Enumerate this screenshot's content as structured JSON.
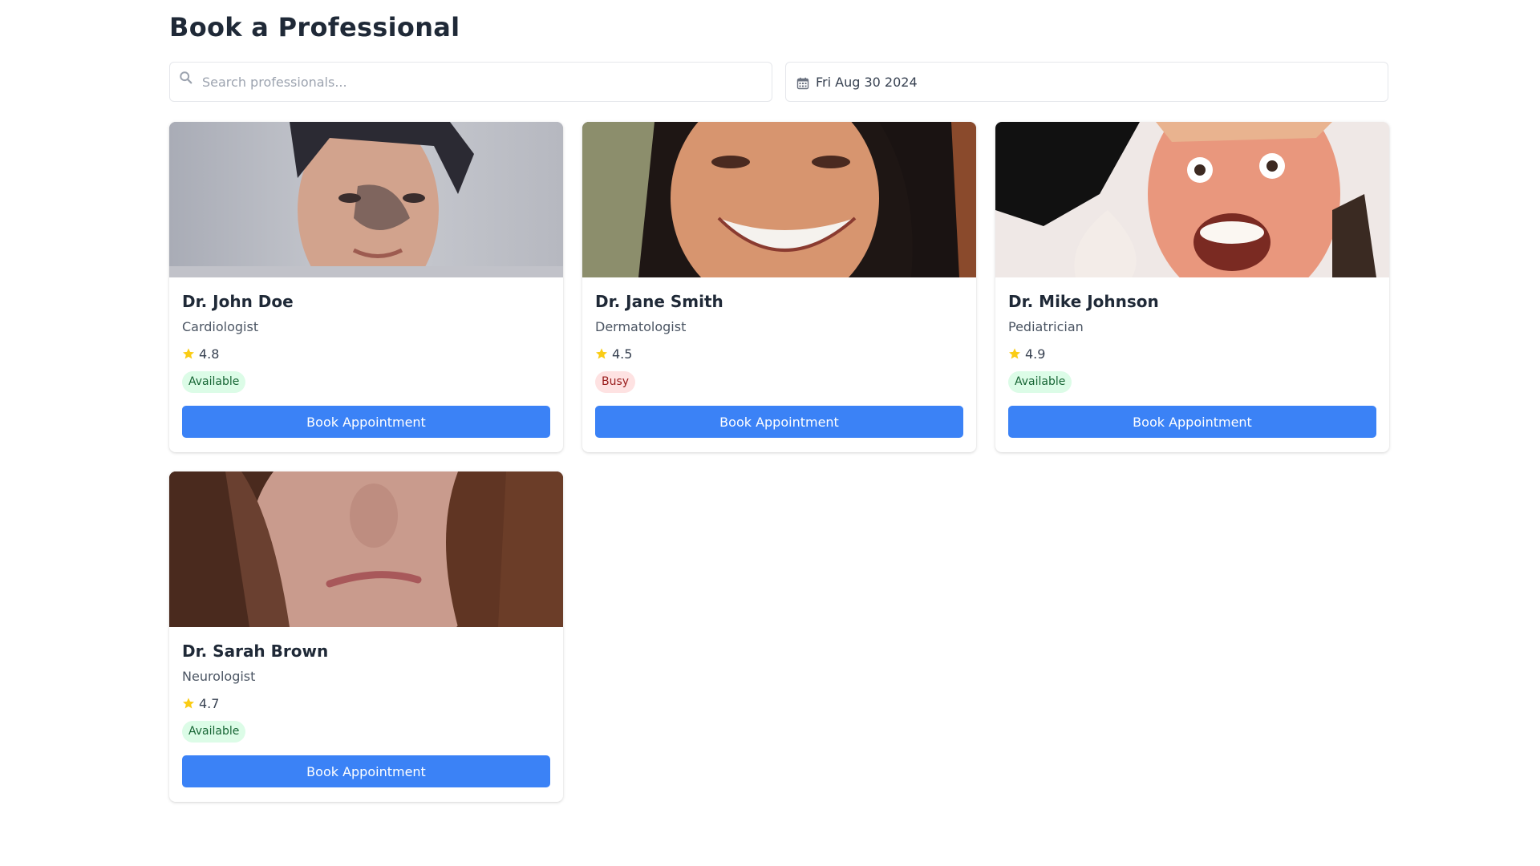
{
  "page": {
    "title": "Book a Professional"
  },
  "search": {
    "placeholder": "Search professionals...",
    "value": "",
    "icon": "search-icon"
  },
  "date": {
    "value": "Fri Aug 30 2024",
    "icon": "calendar-icon"
  },
  "colors": {
    "primary": "#3b82f6",
    "star": "#facc15",
    "available_bg": "#dcfce7",
    "available_text": "#166534",
    "busy_bg": "#fee2e2",
    "busy_text": "#991b1b"
  },
  "professionals": [
    {
      "name": "Dr. John Doe",
      "specialty": "Cardiologist",
      "rating": "4.8",
      "status": "Available",
      "button": "Book Appointment",
      "photo": "portrait of young man with dark hair"
    },
    {
      "name": "Dr. Jane Smith",
      "specialty": "Dermatologist",
      "rating": "4.5",
      "status": "Busy",
      "button": "Book Appointment",
      "photo": "portrait of smiling woman with dark hair"
    },
    {
      "name": "Dr. Mike Johnson",
      "specialty": "Pediatrician",
      "rating": "4.9",
      "status": "Available",
      "button": "Book Appointment",
      "photo": "portrait of man with excited expression"
    },
    {
      "name": "Dr. Sarah Brown",
      "specialty": "Neurologist",
      "rating": "4.7",
      "status": "Available",
      "button": "Book Appointment",
      "photo": "portrait of woman with long brown hair"
    }
  ]
}
